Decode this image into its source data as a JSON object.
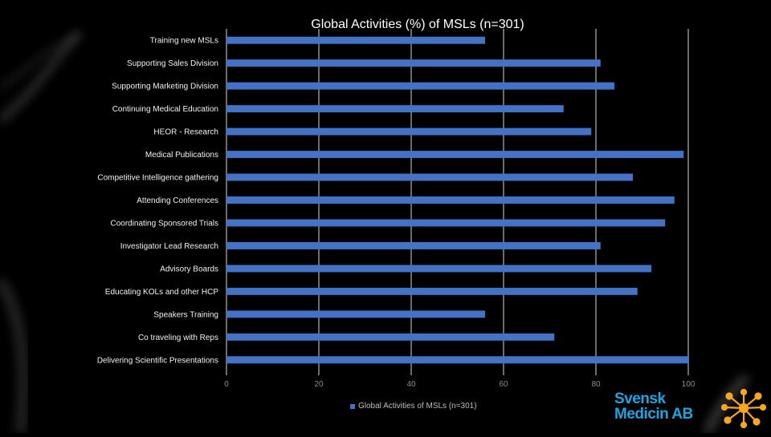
{
  "chart_data": {
    "type": "bar",
    "orientation": "horizontal",
    "title": "Global Activities (%) of MSLs (n=301)",
    "xlabel": "",
    "ylabel": "",
    "xlim": [
      0,
      100
    ],
    "xticks": [
      0,
      20,
      40,
      60,
      80,
      100
    ],
    "grid": true,
    "legend_position": "bottom",
    "categories": [
      "Training new MSLs",
      "Supporting Sales Division",
      "Supporting Marketing Division",
      "Continuing Medical Education",
      "HEOR - Research",
      "Medical Publications",
      "Competitive Intelligence gathering",
      "Attending Conferences",
      "Coordinating Sponsored Trials",
      "Investigator Lead Research",
      "Advisory Boards",
      "Educating KOLs and other HCP",
      "Speakers Training",
      "Co traveling with Reps",
      "Delivering Scientific Presentations"
    ],
    "series": [
      {
        "name": "Global Activities of MSLs (n=301)",
        "color": "#4472c4",
        "values": [
          56,
          81,
          84,
          73,
          79,
          99,
          88,
          97,
          95,
          81,
          92,
          89,
          56,
          71,
          100
        ]
      }
    ]
  },
  "branding": {
    "logo_line1": "Svensk",
    "logo_line2": "Medicin AB",
    "logo_color": "#1fa4e0",
    "logo_star_color": "#f5a623"
  }
}
